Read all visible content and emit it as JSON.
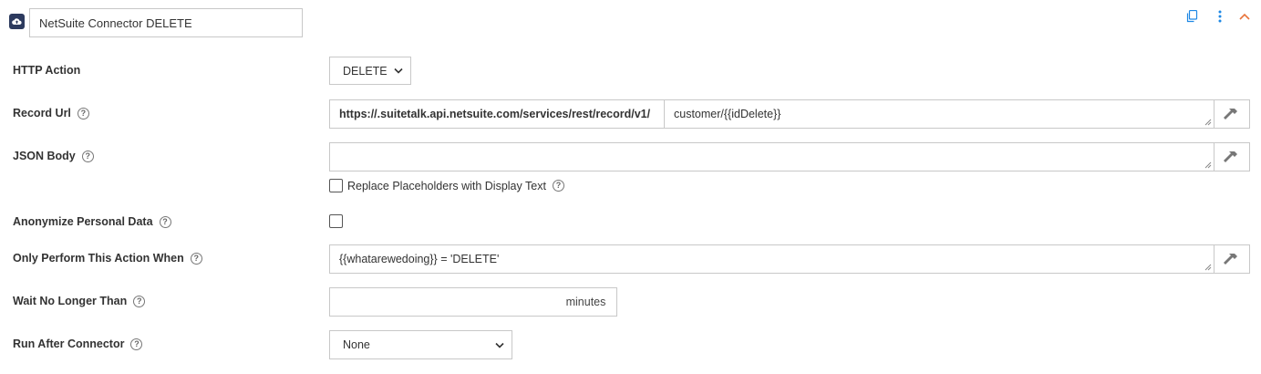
{
  "header": {
    "connector_name": "NetSuite Connector DELETE",
    "icons": [
      "cloud-icon",
      "copy-icon",
      "more-vertical-icon",
      "chevron-up-icon"
    ],
    "accent_color": "#1e88e5",
    "collapse_color": "#e8743b"
  },
  "fields": {
    "http_action": {
      "label": "HTTP Action",
      "value": "DELETE"
    },
    "record_url": {
      "label": "Record Url",
      "prefix": "https://.suitetalk.api.netsuite.com/services/rest/record/v1/",
      "value": "customer/{{idDelete}}"
    },
    "json_body": {
      "label": "JSON Body",
      "value": "",
      "replace_placeholders_label": "Replace Placeholders with Display Text",
      "replace_placeholders_checked": false
    },
    "anonymize": {
      "label": "Anonymize Personal Data",
      "checked": false
    },
    "only_perform_when": {
      "label": "Only Perform This Action When",
      "value": "{{whatarewedoing}} = 'DELETE'"
    },
    "wait_no_longer": {
      "label": "Wait No Longer Than",
      "value": "",
      "unit": "minutes"
    },
    "run_after": {
      "label": "Run After Connector",
      "value": "None"
    }
  },
  "help_icon_glyph": "?"
}
